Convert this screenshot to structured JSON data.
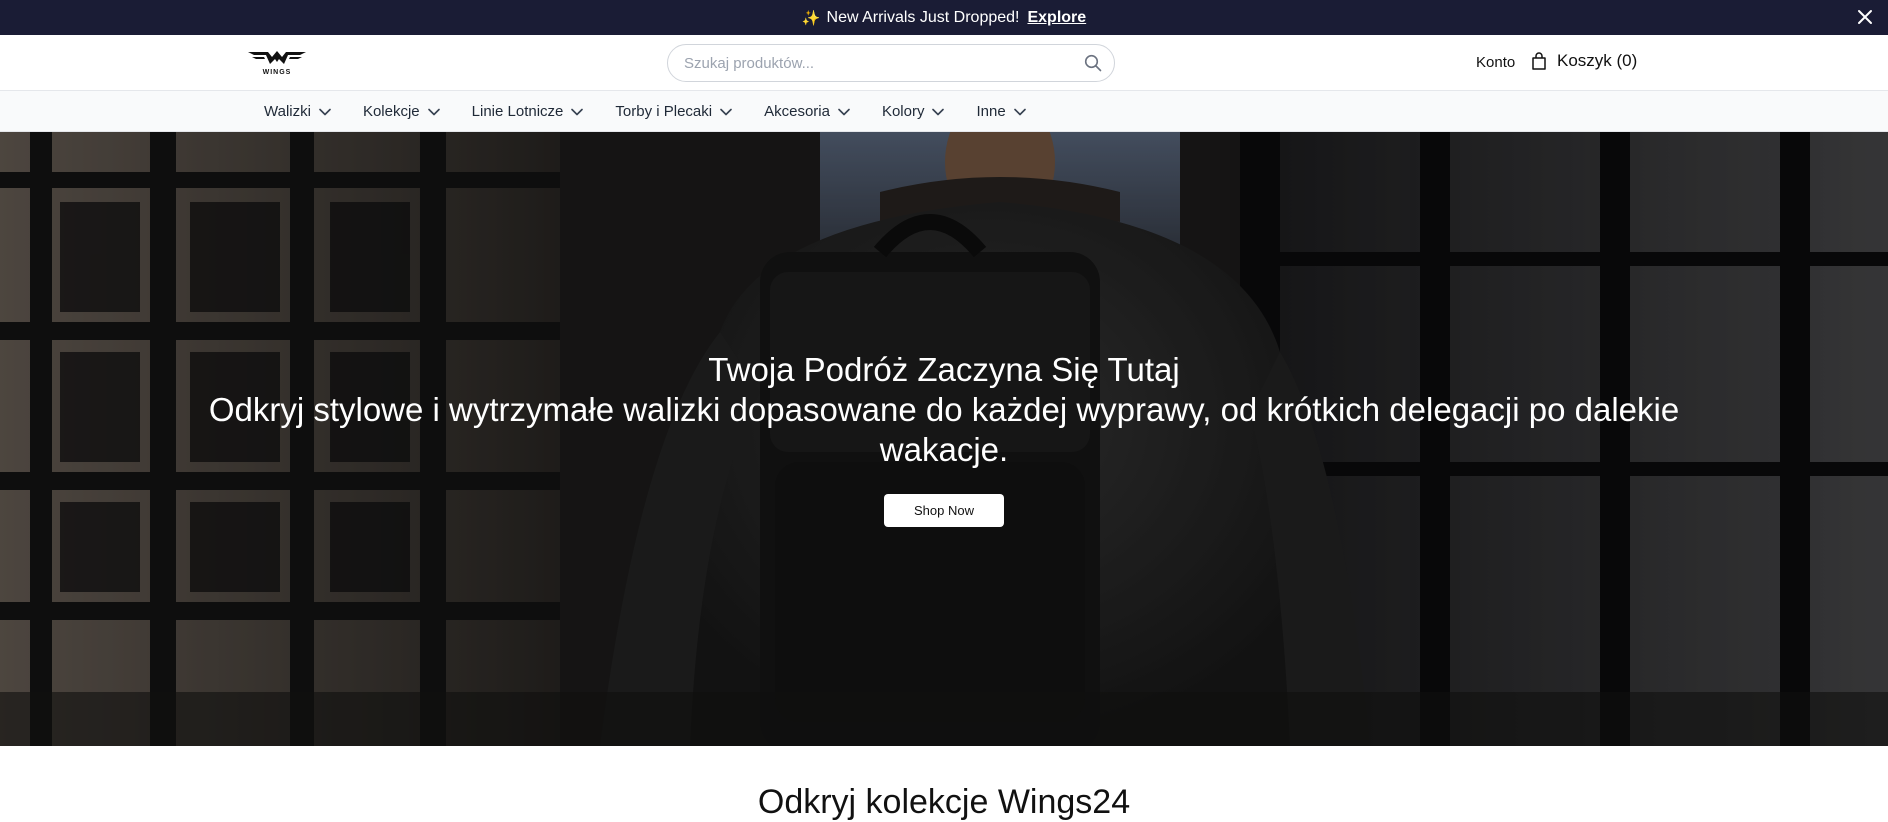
{
  "announcement": {
    "icon": "sparkles-icon",
    "message": "New Arrivals Just Dropped!",
    "link_label": "Explore"
  },
  "header": {
    "logo_text": "WINGS",
    "search_placeholder": "Szukaj produktów...",
    "account_label": "Konto",
    "cart_label": "Koszyk (0)"
  },
  "nav": {
    "items": [
      {
        "label": "Walizki"
      },
      {
        "label": "Kolekcje"
      },
      {
        "label": "Linie Lotnicze"
      },
      {
        "label": "Torby i Plecaki"
      },
      {
        "label": "Akcesoria"
      },
      {
        "label": "Kolory"
      },
      {
        "label": "Inne"
      }
    ]
  },
  "hero": {
    "title": "Twoja Podróż Zaczyna Się Tutaj",
    "subtitle": "Odkryj stylowe i wytrzymałe walizki dopasowane do każdej wyprawy, od krótkich delegacji po dalekie wakacje.",
    "cta_label": "Shop Now"
  },
  "collections": {
    "title": "Odkryj kolekcje Wings24"
  },
  "colors": {
    "announcement_bg": "#1a1c35",
    "nav_bg": "#f9fafb",
    "cta_bg": "#ffffff"
  }
}
